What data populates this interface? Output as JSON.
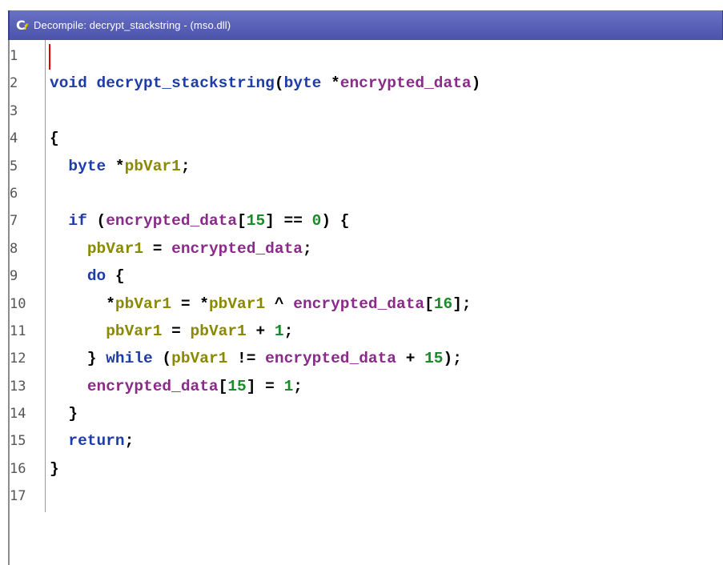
{
  "window": {
    "title": "Decompile: decrypt_stackstring - (mso.dll)",
    "icon_letter": "C",
    "icon_sub": "f"
  },
  "colors": {
    "keyword": "#1e3ca8",
    "param": "#8a2a8a",
    "local": "#8a8a00",
    "number": "#1a8a2a",
    "titlebar": "#5a62b8"
  },
  "lines": [
    {
      "n": "1",
      "tokens": []
    },
    {
      "n": "2",
      "tokens": [
        {
          "t": "void",
          "c": "kw"
        },
        {
          "t": " ",
          "c": "pun"
        },
        {
          "t": "decrypt_stackstring",
          "c": "fn"
        },
        {
          "t": "(",
          "c": "pun"
        },
        {
          "t": "byte",
          "c": "kw"
        },
        {
          "t": " *",
          "c": "pun"
        },
        {
          "t": "encrypted_data",
          "c": "var"
        },
        {
          "t": ")",
          "c": "pun"
        }
      ]
    },
    {
      "n": "3",
      "tokens": []
    },
    {
      "n": "4",
      "tokens": [
        {
          "t": "{",
          "c": "pun"
        }
      ]
    },
    {
      "n": "5",
      "tokens": [
        {
          "t": "  ",
          "c": "pun"
        },
        {
          "t": "byte",
          "c": "kw"
        },
        {
          "t": " *",
          "c": "pun"
        },
        {
          "t": "pbVar1",
          "c": "loc"
        },
        {
          "t": ";",
          "c": "pun"
        }
      ]
    },
    {
      "n": "6",
      "tokens": []
    },
    {
      "n": "7",
      "tokens": [
        {
          "t": "  ",
          "c": "pun"
        },
        {
          "t": "if",
          "c": "kw"
        },
        {
          "t": " (",
          "c": "pun"
        },
        {
          "t": "encrypted_data",
          "c": "var"
        },
        {
          "t": "[",
          "c": "pun"
        },
        {
          "t": "15",
          "c": "num"
        },
        {
          "t": "] == ",
          "c": "pun"
        },
        {
          "t": "0",
          "c": "num"
        },
        {
          "t": ") {",
          "c": "pun"
        }
      ]
    },
    {
      "n": "8",
      "tokens": [
        {
          "t": "    ",
          "c": "pun"
        },
        {
          "t": "pbVar1",
          "c": "loc"
        },
        {
          "t": " = ",
          "c": "pun"
        },
        {
          "t": "encrypted_data",
          "c": "var"
        },
        {
          "t": ";",
          "c": "pun"
        }
      ]
    },
    {
      "n": "9",
      "tokens": [
        {
          "t": "    ",
          "c": "pun"
        },
        {
          "t": "do",
          "c": "kw"
        },
        {
          "t": " {",
          "c": "pun"
        }
      ]
    },
    {
      "n": "10",
      "tokens": [
        {
          "t": "      *",
          "c": "pun"
        },
        {
          "t": "pbVar1",
          "c": "loc"
        },
        {
          "t": " = *",
          "c": "pun"
        },
        {
          "t": "pbVar1",
          "c": "loc"
        },
        {
          "t": " ^ ",
          "c": "pun"
        },
        {
          "t": "encrypted_data",
          "c": "var"
        },
        {
          "t": "[",
          "c": "pun"
        },
        {
          "t": "16",
          "c": "num"
        },
        {
          "t": "];",
          "c": "pun"
        }
      ]
    },
    {
      "n": "11",
      "tokens": [
        {
          "t": "      ",
          "c": "pun"
        },
        {
          "t": "pbVar1",
          "c": "loc"
        },
        {
          "t": " = ",
          "c": "pun"
        },
        {
          "t": "pbVar1",
          "c": "loc"
        },
        {
          "t": " + ",
          "c": "pun"
        },
        {
          "t": "1",
          "c": "num"
        },
        {
          "t": ";",
          "c": "pun"
        }
      ]
    },
    {
      "n": "12",
      "tokens": [
        {
          "t": "    } ",
          "c": "pun"
        },
        {
          "t": "while",
          "c": "kw"
        },
        {
          "t": " (",
          "c": "pun"
        },
        {
          "t": "pbVar1",
          "c": "loc"
        },
        {
          "t": " != ",
          "c": "pun"
        },
        {
          "t": "encrypted_data",
          "c": "var"
        },
        {
          "t": " + ",
          "c": "pun"
        },
        {
          "t": "15",
          "c": "num"
        },
        {
          "t": ");",
          "c": "pun"
        }
      ]
    },
    {
      "n": "13",
      "tokens": [
        {
          "t": "    ",
          "c": "pun"
        },
        {
          "t": "encrypted_data",
          "c": "var"
        },
        {
          "t": "[",
          "c": "pun"
        },
        {
          "t": "15",
          "c": "num"
        },
        {
          "t": "] = ",
          "c": "pun"
        },
        {
          "t": "1",
          "c": "num"
        },
        {
          "t": ";",
          "c": "pun"
        }
      ]
    },
    {
      "n": "14",
      "tokens": [
        {
          "t": "  }",
          "c": "pun"
        }
      ]
    },
    {
      "n": "15",
      "tokens": [
        {
          "t": "  ",
          "c": "pun"
        },
        {
          "t": "return",
          "c": "kw"
        },
        {
          "t": ";",
          "c": "pun"
        }
      ]
    },
    {
      "n": "16",
      "tokens": [
        {
          "t": "}",
          "c": "pun"
        }
      ]
    },
    {
      "n": "17",
      "tokens": []
    }
  ]
}
